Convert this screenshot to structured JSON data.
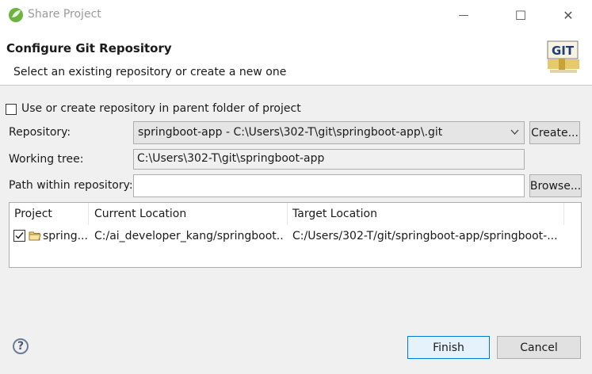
{
  "window": {
    "title": "Share Project",
    "controls": {
      "minimize": "—",
      "maximize": "☐",
      "close": "✕"
    }
  },
  "header": {
    "title": "Configure Git Repository",
    "description": "Select an existing repository or create a new one",
    "logo_text": "GIT"
  },
  "form": {
    "use_parent_label": "Use or create repository in parent folder of project",
    "use_parent_checked": false,
    "repository_label": "Repository:",
    "repository_value": "springboot-app - C:\\Users\\302-T\\git\\springboot-app\\.git",
    "create_button": "Create...",
    "working_tree_label": "Working tree:",
    "working_tree_value": "C:\\Users\\302-T\\git\\springboot-app",
    "path_label": "Path within repository:",
    "path_value": "",
    "browse_button": "Browse..."
  },
  "table": {
    "columns": [
      "Project",
      "Current Location",
      "Target Location"
    ],
    "rows": [
      {
        "checked": true,
        "project": "spring...",
        "current_location": "C:/ai_developer_kang/springboot...",
        "target_location": "C:/Users/302-T/git/springboot-app/springboot-..."
      }
    ]
  },
  "footer": {
    "help": "?",
    "finish_button": "Finish",
    "cancel_button": "Cancel"
  },
  "colors": {
    "background": "#f0f0f0",
    "header_bg": "#ffffff",
    "default_button_border": "#0078d7",
    "default_button_bg": "#e5f1fb"
  }
}
